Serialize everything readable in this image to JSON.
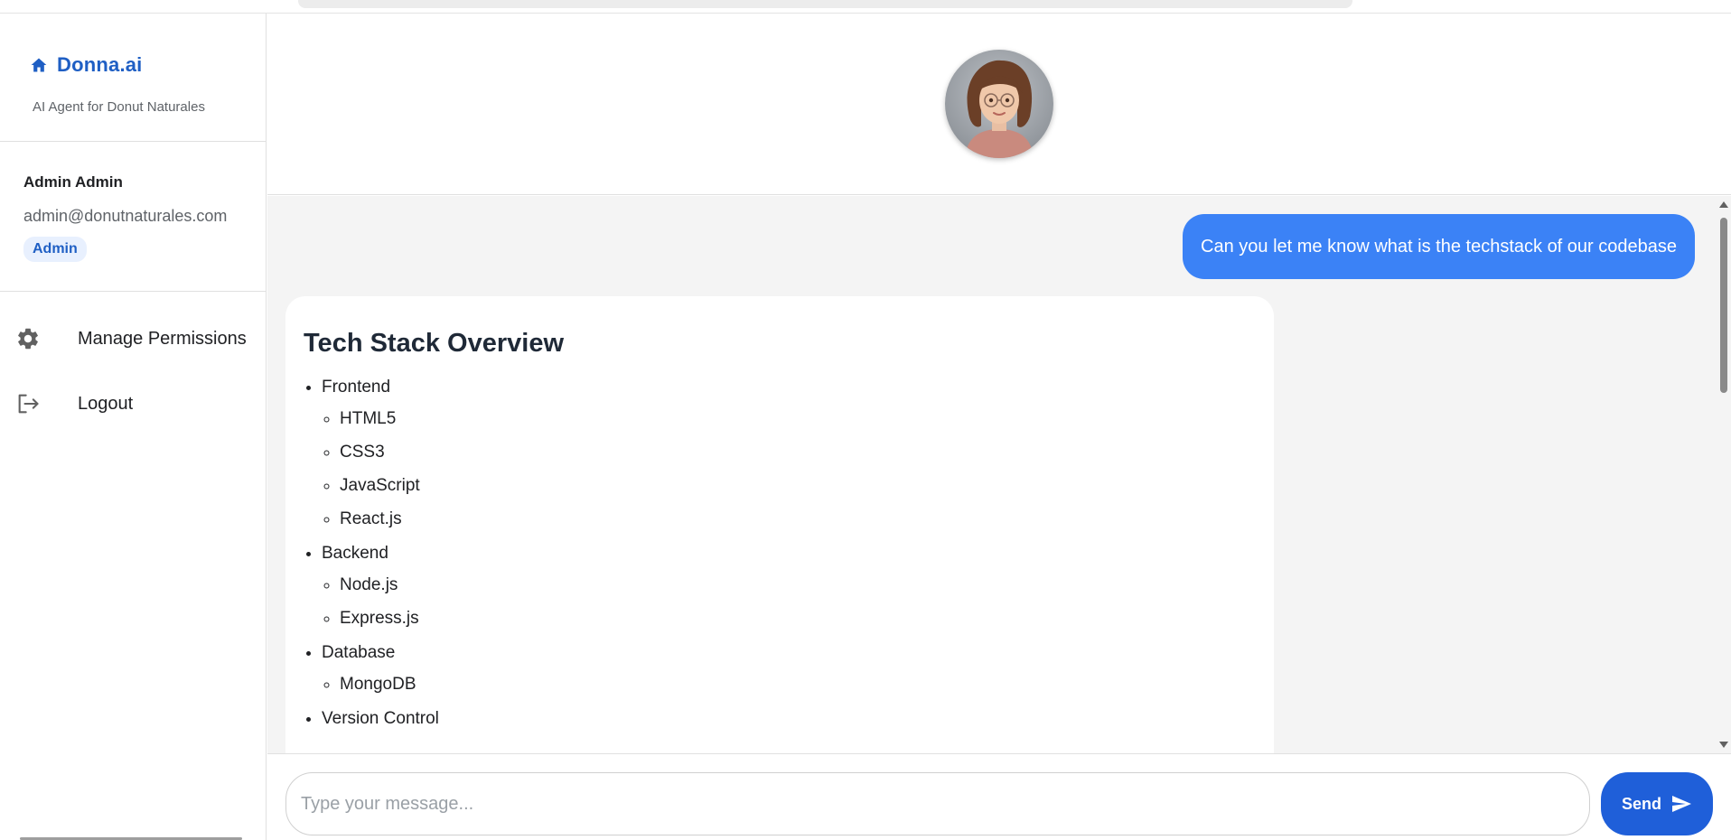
{
  "brand": {
    "name": "Donna.ai",
    "tagline": "AI Agent for Donut Naturales",
    "icon": "home-icon"
  },
  "user": {
    "name": "Admin Admin",
    "email": "admin@donutnaturales.com",
    "role": "Admin"
  },
  "nav": [
    {
      "label": "Manage Permissions",
      "icon": "gear-icon"
    },
    {
      "label": "Logout",
      "icon": "logout-icon"
    }
  ],
  "colors": {
    "accent": "#1f5fc4",
    "user_bubble": "#3b82f6",
    "send_button": "#1f5fd9",
    "chat_bg": "#f4f4f4"
  },
  "chat": {
    "user_message": "Can you let me know what is the techstack of our codebase",
    "bot": {
      "title": "Tech Stack Overview",
      "sections": [
        {
          "name": "Frontend",
          "items": [
            "HTML5",
            "CSS3",
            "JavaScript",
            "React.js"
          ]
        },
        {
          "name": "Backend",
          "items": [
            "Node.js",
            "Express.js"
          ]
        },
        {
          "name": "Database",
          "items": [
            "MongoDB"
          ]
        },
        {
          "name": "Version Control",
          "items": []
        }
      ]
    }
  },
  "composer": {
    "placeholder": "Type your message...",
    "send_label": "Send",
    "send_icon": "send-icon"
  }
}
